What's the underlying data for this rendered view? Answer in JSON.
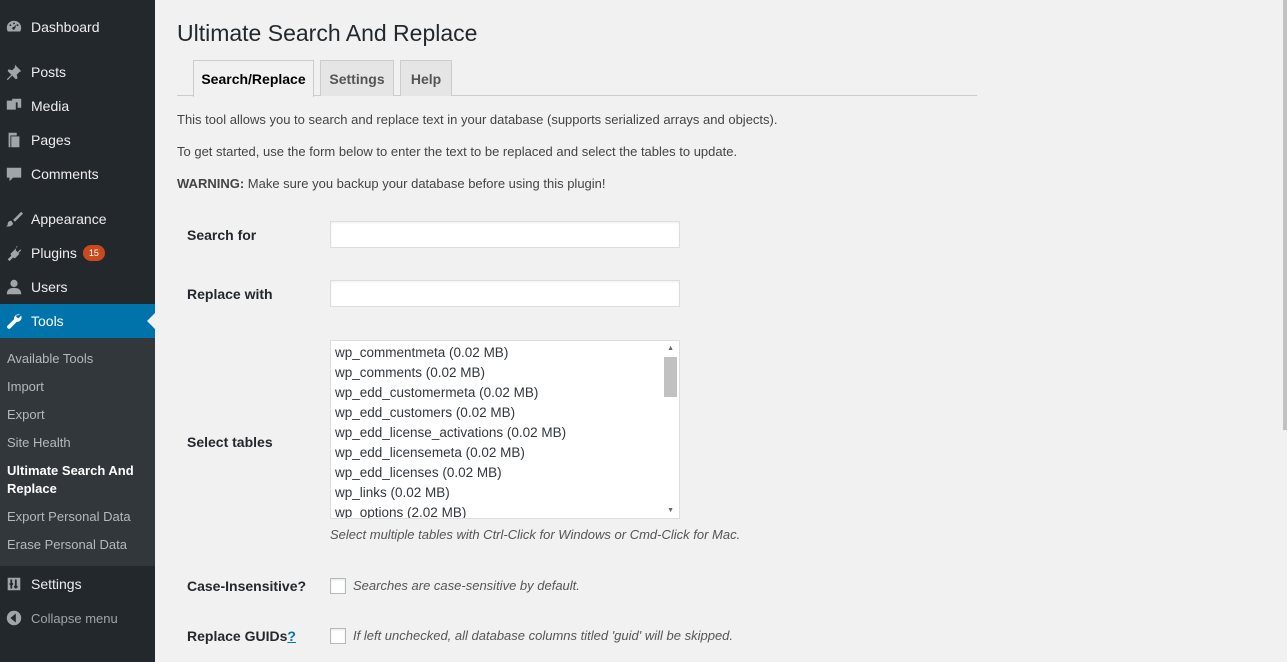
{
  "sidebar": {
    "items": [
      {
        "label": "Dashboard",
        "icon": "dashboard-icon"
      },
      {
        "label": "Posts",
        "icon": "pushpin-icon"
      },
      {
        "label": "Media",
        "icon": "media-icon"
      },
      {
        "label": "Pages",
        "icon": "pages-icon"
      },
      {
        "label": "Comments",
        "icon": "comment-icon"
      },
      {
        "label": "Appearance",
        "icon": "paintbrush-icon"
      },
      {
        "label": "Plugins",
        "icon": "plugin-icon",
        "badge": "15"
      },
      {
        "label": "Users",
        "icon": "user-icon"
      },
      {
        "label": "Tools",
        "icon": "wrench-icon"
      },
      {
        "label": "Settings",
        "icon": "settings-icon"
      },
      {
        "label": "Collapse menu",
        "icon": "collapse-icon"
      }
    ],
    "submenu": [
      "Available Tools",
      "Import",
      "Export",
      "Site Health",
      "Ultimate Search And Replace",
      "Export Personal Data",
      "Erase Personal Data"
    ]
  },
  "page": {
    "title": "Ultimate Search And Replace",
    "tabs": [
      "Search/Replace",
      "Settings",
      "Help"
    ],
    "intro1": "This tool allows you to search and replace text in your database (supports serialized arrays and objects).",
    "intro2": "To get started, use the form below to enter the text to be replaced and select the tables to update.",
    "warning_label": "WARNING:",
    "warning_text": " Make sure you backup your database before using this plugin!"
  },
  "form": {
    "search_label": "Search for",
    "search_value": "",
    "replace_label": "Replace with",
    "replace_value": "",
    "tables_label": "Select tables",
    "tables": [
      "wp_commentmeta (0.02 MB)",
      "wp_comments (0.02 MB)",
      "wp_edd_customermeta (0.02 MB)",
      "wp_edd_customers (0.02 MB)",
      "wp_edd_license_activations (0.02 MB)",
      "wp_edd_licensemeta (0.02 MB)",
      "wp_edd_licenses (0.02 MB)",
      "wp_links (0.02 MB)",
      "wp_options (2.02 MB)"
    ],
    "tables_help": "Select multiple tables with Ctrl-Click for Windows or Cmd-Click for Mac.",
    "case_label": "Case-Insensitive?",
    "case_desc": "Searches are case-sensitive by default.",
    "guid_label": "Replace GUIDs",
    "guid_help_link": "?",
    "guid_desc": "If left unchecked, all database columns titled 'guid' will be skipped."
  }
}
